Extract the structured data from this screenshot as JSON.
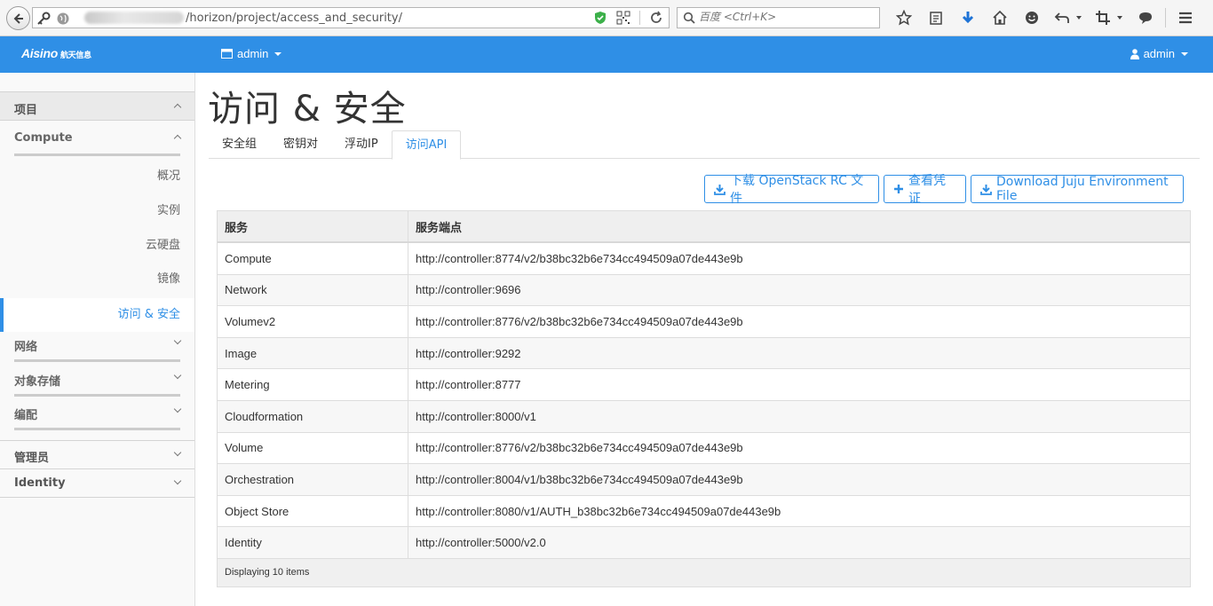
{
  "browser": {
    "url": "/horizon/project/access_and_security/",
    "search_placeholder": "百度 <Ctrl+K>"
  },
  "header": {
    "brand": "Aisino",
    "brand_sub": "航天信息",
    "project": "admin",
    "user": "admin"
  },
  "sidebar": {
    "section": "项目",
    "compute": "Compute",
    "items": [
      "概况",
      "实例",
      "云硬盘",
      "镜像",
      "访问 & 安全"
    ],
    "groups": [
      "网络",
      "对象存储",
      "编配"
    ],
    "admin": "管理员",
    "identity": "Identity"
  },
  "page": {
    "title": "访问 & 安全",
    "tabs": [
      "安全组",
      "密钥对",
      "浮动IP",
      "访问API"
    ],
    "active_tab": "访问API"
  },
  "actions": {
    "download_rc": "下载 OpenStack RC 文件",
    "view_credentials": "查看凭证",
    "download_juju": "Download Juju Environment File"
  },
  "table": {
    "headers": [
      "服务",
      "服务端点"
    ],
    "rows": [
      [
        "Compute",
        "http://controller:8774/v2/b38bc32b6e734cc494509a07de443e9b"
      ],
      [
        "Network",
        "http://controller:9696"
      ],
      [
        "Volumev2",
        "http://controller:8776/v2/b38bc32b6e734cc494509a07de443e9b"
      ],
      [
        "Image",
        "http://controller:9292"
      ],
      [
        "Metering",
        "http://controller:8777"
      ],
      [
        "Cloudformation",
        "http://controller:8000/v1"
      ],
      [
        "Volume",
        "http://controller:8776/v2/b38bc32b6e734cc494509a07de443e9b"
      ],
      [
        "Orchestration",
        "http://controller:8004/v1/b38bc32b6e734cc494509a07de443e9b"
      ],
      [
        "Object Store",
        "http://controller:8080/v1/AUTH_b38bc32b6e734cc494509a07de443e9b"
      ],
      [
        "Identity",
        "http://controller:5000/v2.0"
      ]
    ],
    "footer": "Displaying 10 items"
  },
  "colors": {
    "accent": "#2f8fe6",
    "header_bg": "#2f8fe6"
  }
}
